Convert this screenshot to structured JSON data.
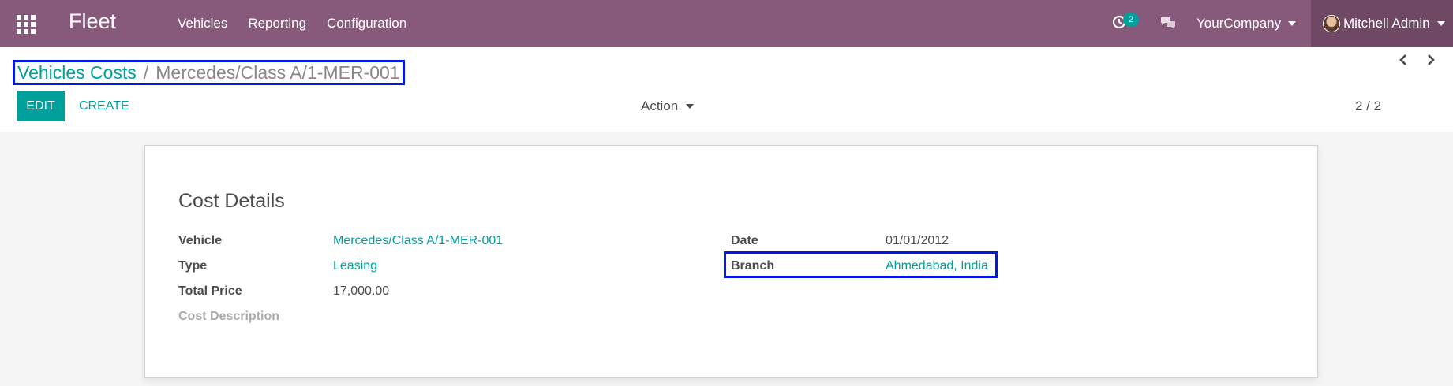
{
  "navbar": {
    "brand": "Fleet",
    "menu": [
      "Vehicles",
      "Reporting",
      "Configuration"
    ],
    "activity_count": "2",
    "company": "YourCompany",
    "user": "Mitchell Admin"
  },
  "breadcrumb": {
    "parent": "Vehicles Costs",
    "separator": "/",
    "current": "Mercedes/Class A/1-MER-001"
  },
  "buttons": {
    "edit": "EDIT",
    "create": "CREATE",
    "action": "Action"
  },
  "pager": {
    "value": "2 / 2"
  },
  "form": {
    "title": "Cost Details",
    "fields": {
      "vehicle": {
        "label": "Vehicle",
        "value": "Mercedes/Class A/1-MER-001"
      },
      "type": {
        "label": "Type",
        "value": "Leasing"
      },
      "total_price": {
        "label": "Total Price",
        "value": "17,000.00"
      },
      "cost_description": {
        "label": "Cost Description",
        "value": ""
      },
      "date": {
        "label": "Date",
        "value": "01/01/2012"
      },
      "branch": {
        "label": "Branch",
        "value": "Ahmedabad, India"
      }
    }
  },
  "colors": {
    "navbar": "#875a7b",
    "accent": "#00a09d",
    "highlight": "#0018e6"
  }
}
